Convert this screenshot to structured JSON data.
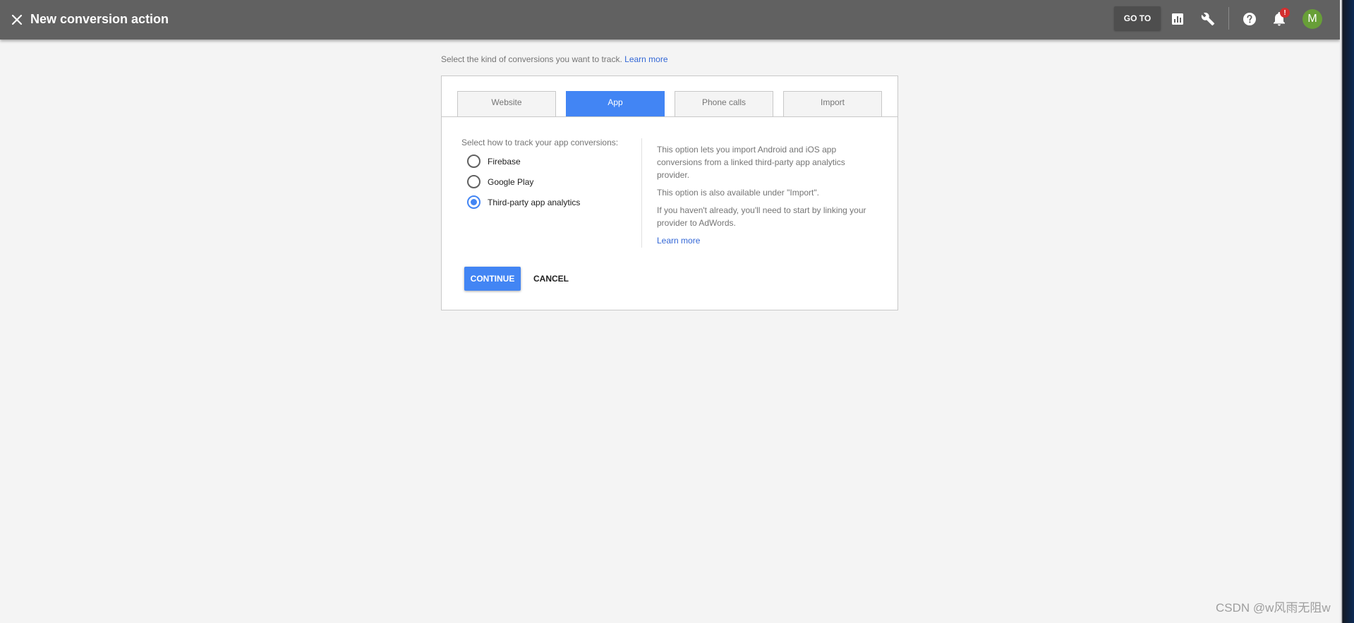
{
  "header": {
    "title": "New conversion action",
    "goto_label": "GO TO",
    "notification_badge": "!",
    "avatar_initial": "M"
  },
  "intro": {
    "text": "Select the kind of conversions you want to track.",
    "link": "Learn more"
  },
  "tabs": [
    {
      "label": "Website",
      "active": false
    },
    {
      "label": "App",
      "active": true
    },
    {
      "label": "Phone calls",
      "active": false
    },
    {
      "label": "Import",
      "active": false
    }
  ],
  "tracking": {
    "label": "Select how to track your app conversions:",
    "options": [
      {
        "label": "Firebase",
        "checked": false
      },
      {
        "label": "Google Play",
        "checked": false
      },
      {
        "label": "Third-party app analytics",
        "checked": true
      }
    ]
  },
  "info": {
    "p1": "This option lets you import Android and iOS app conversions from a linked third-party app analytics provider.",
    "p2": "This option is also available under \"Import\".",
    "p3": "If you haven't already, you'll need to start by linking your provider to AdWords.",
    "link": "Learn more"
  },
  "actions": {
    "continue_label": "CONTINUE",
    "cancel_label": "CANCEL"
  },
  "watermark": "CSDN @w风雨无阻w",
  "colors": {
    "accent": "#4285f4",
    "topbar": "#616161",
    "link": "#3367d6",
    "avatar": "#689f38",
    "badge": "#d32f2f"
  }
}
